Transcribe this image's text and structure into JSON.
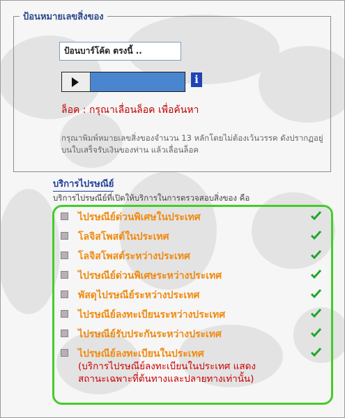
{
  "tracking": {
    "legend": "ป้อนหมายเลขสิ่งของ",
    "input_value": "ป้อนบาร์โค้ด ตรงนี้ ..",
    "info_icon_glyph": "i",
    "lock_message": "ล็อค : กรุณาเลื่อนล็อค เพื่อค้นหา",
    "instruction": "กรุณาพิมพ์หมายเลขสิ่งของจำนวน 13 หลักโดยไม่ต้องเว้นวรรค ดังปรากฏอยู่บนใบเสร็จรับเงินของท่าน แล้วเลื่อนล็อค"
  },
  "services": {
    "title": "บริการไปรษณีย์",
    "description": "บริการไปรษณีย์ที่เปิดให้บริการในการตรวจสอบสิ่งของ คือ",
    "items": [
      {
        "label": "ไปรษณีย์ด่วนพิเศษในประเทศ"
      },
      {
        "label": "โลจิสโพสต์ในประเทศ"
      },
      {
        "label": "โลจิสโพสต์ระหว่างประเทศ"
      },
      {
        "label": "ไปรษณีย์ด่วนพิเศษระหว่างประเทศ"
      },
      {
        "label": "พัสดุไปรษณีย์ระหว่างประเทศ"
      },
      {
        "label": "ไปรษณีย์ลงทะเบียนระหว่างประเทศ"
      },
      {
        "label": "ไปรษณีย์รับประกันระหว่างประเทศ"
      },
      {
        "label": "ไปรษณีย์ลงทะเบียนในประเทศ",
        "note": "(บริการไปรษณีย์ลงทะเบียนในประเทศ แสดงสถานะเฉพาะที่ต้นทางและปลายทางเท่านั้น)"
      }
    ]
  },
  "colors": {
    "legend": "#2c4a8c",
    "lock_message": "#c00000",
    "service_label": "#f08a10",
    "check": "#22a52b",
    "box_border": "#44cc2b"
  }
}
